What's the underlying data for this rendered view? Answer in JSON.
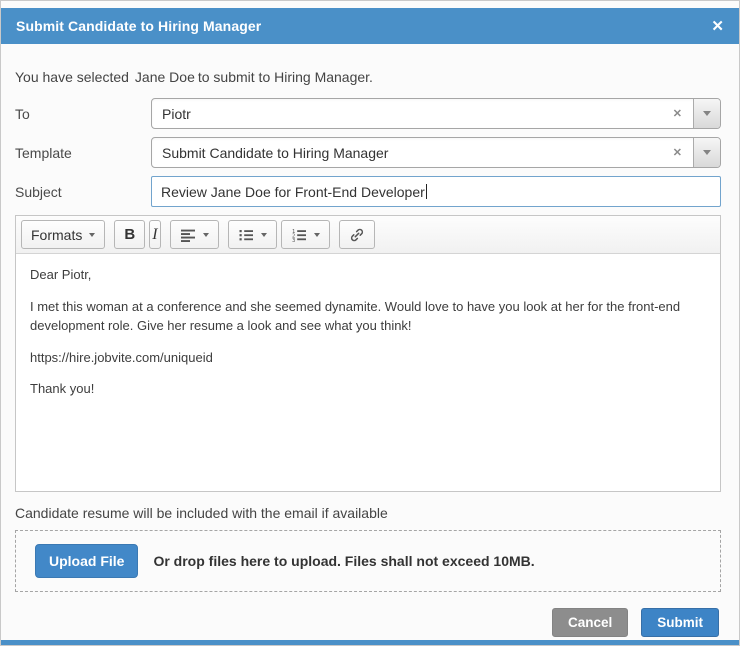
{
  "colors": {
    "header_blue": "#4a90c8",
    "accent_blue": "#3d84c6",
    "upload_button_blue": "#4288c8",
    "cancel_gray": "#8d8d8d",
    "focused_input_border": "#72a4cd"
  },
  "icons": {
    "close": "✕",
    "clear": "✕",
    "dropdown": "caret-down",
    "align": "align-left",
    "bullet_list": "unordered-list",
    "numbered_list": "ordered-list",
    "link": "chain-link"
  },
  "header": {
    "title": "Submit Candidate to Hiring Manager"
  },
  "intro": {
    "prefix": "You have selected",
    "candidate": "Jane Doe",
    "suffix": "to submit to Hiring Manager."
  },
  "fields": {
    "to": {
      "label": "To",
      "value": "Piotr"
    },
    "template": {
      "label": "Template",
      "value": "Submit Candidate to Hiring Manager"
    },
    "subject": {
      "label": "Subject",
      "value": "Review Jane Doe for Front-End Developer"
    }
  },
  "editor": {
    "toolbar": {
      "formats": "Formats",
      "bold": "B",
      "italic": "I"
    },
    "body": [
      "Dear Piotr,",
      "I met this woman at a conference and she seemed dynamite. Would love to have you look at her for the front-end development role. Give her resume a look and see what you think!",
      "https://hire.jobvite.com/uniqueid",
      "Thank you!"
    ]
  },
  "note": "Candidate resume will be included with the email if available",
  "upload": {
    "button": "Upload File",
    "hint": "Or drop files here to upload. Files shall not exceed 10MB."
  },
  "footer": {
    "cancel": "Cancel",
    "submit": "Submit"
  }
}
